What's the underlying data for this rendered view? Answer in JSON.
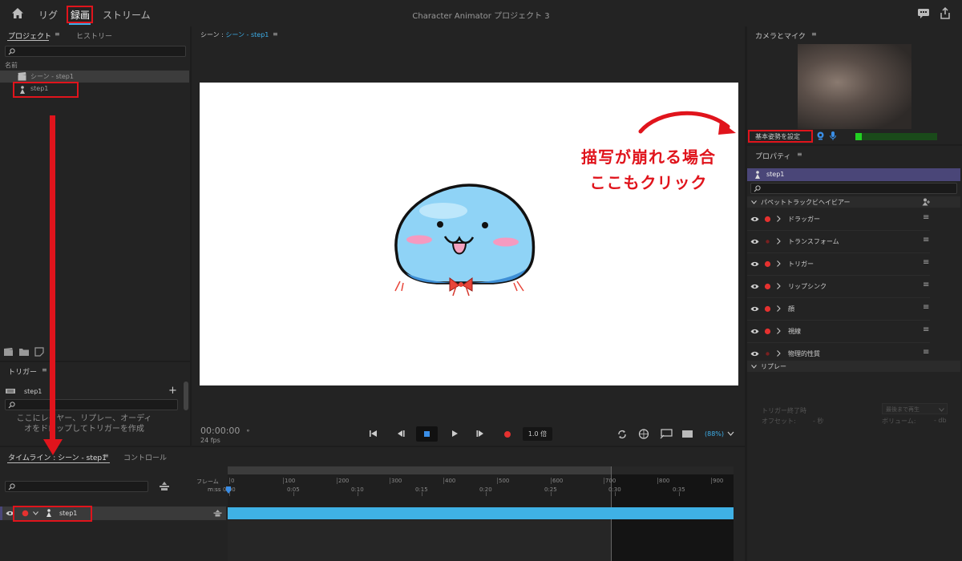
{
  "header": {
    "tabs": [
      "リグ",
      "録画",
      "ストリーム"
    ],
    "title": "Character Animator プロジェクト 3"
  },
  "project_panel": {
    "tabs": [
      "プロジェクト",
      "ヒストリー"
    ],
    "column_name": "名前",
    "items": [
      {
        "label": "シーン - step1",
        "icon": "scene-icon"
      },
      {
        "label": "step1",
        "icon": "puppet-icon"
      }
    ]
  },
  "triggers_panel": {
    "title": "トリガー",
    "item": "step1",
    "add": "+",
    "hint": "ここにレイヤー、リプレー、オーディオをドロップしてトリガーを作成"
  },
  "scene_panel": {
    "title_prefix": "シーン : ",
    "title_scene": "シーン - step1",
    "time": "00:00:00",
    "fps": "24 fps",
    "speed": "1.0 倍",
    "zoom": "(88%)"
  },
  "camera_panel": {
    "title": "カメラとマイク",
    "set_rest_pose": "基本姿勢を設定"
  },
  "annotation": {
    "line1": "描写が崩れる場合",
    "line2": "ここもクリック"
  },
  "properties_panel": {
    "title": "プロパティ",
    "selected": "step1",
    "section": "パペットトラックビヘイビアー",
    "behaviors": [
      "ドラッガー",
      "トランスフォーム",
      "トリガー",
      "リップシンク",
      "顔",
      "視線",
      "物理的性質"
    ],
    "replay_section": "リプレー",
    "replay_trigger_key": "トリガー終了時",
    "replay_trigger_value": "最後まで再生",
    "replay_offset_label": "オフセット:",
    "replay_offset_value": "- 秒",
    "replay_volume_label": "ボリューム:",
    "replay_volume_value": "- db"
  },
  "timeline_panel": {
    "tabs": [
      "タイムライン : シーン - step1",
      "コントロール"
    ],
    "frame_label": "フレーム",
    "time_label": "m:ss",
    "frame_ticks": [
      "0",
      "100",
      "200",
      "300",
      "400",
      "500",
      "600",
      "700",
      "800",
      "900"
    ],
    "time_ticks": [
      "0:00",
      "0:05",
      "0:10",
      "0:15",
      "0:20",
      "0:25",
      "0:30",
      "0:35"
    ],
    "track_label": "step1"
  },
  "colors": {
    "accent_blue": "#3daee9",
    "annotation_red": "#e0141c",
    "track_blue": "#3fb1e5",
    "selection_purple": "#4a4678"
  }
}
